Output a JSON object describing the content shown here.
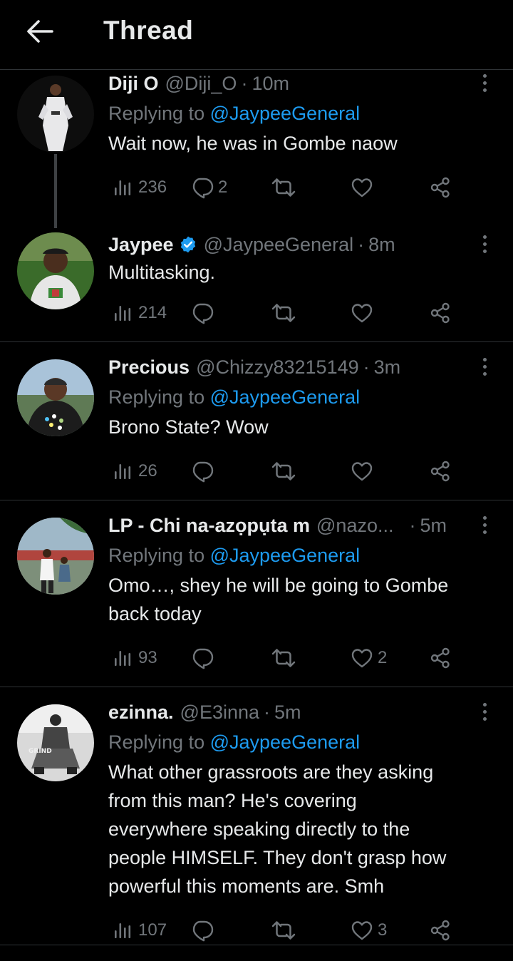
{
  "header": {
    "title": "Thread"
  },
  "tweets": [
    {
      "name": "Diji O",
      "handle": "@Diji_O",
      "dot": "·",
      "time": "10m",
      "replying_prefix": "Replying to ",
      "replying_to": "@JaypeeGeneral",
      "text": "Wait now, he was in Gombe naow",
      "views": "236",
      "replies": "2",
      "retweets": "",
      "likes": ""
    },
    {
      "name": "Jaypee",
      "verified": true,
      "handle": "@JaypeeGeneral",
      "dot": "·",
      "time": "8m",
      "text": "Multitasking.",
      "views": "214",
      "replies": "",
      "retweets": "",
      "likes": ""
    },
    {
      "name": "Precious",
      "handle": "@Chizzy83215149",
      "dot": "·",
      "time": "3m",
      "replying_prefix": "Replying to ",
      "replying_to": "@JaypeeGeneral",
      "text": "Brono State? Wow",
      "views": "26",
      "replies": "",
      "retweets": "",
      "likes": ""
    },
    {
      "name": "LP - Chi na-azọpụta m",
      "handle": "@nazo...",
      "dot": "·",
      "time": "5m",
      "replying_prefix": "Replying to ",
      "replying_to": "@JaypeeGeneral",
      "text_line1": "Omo…, shey he will be going to Gombe",
      "text_line2": "back today",
      "views": "93",
      "replies": "",
      "retweets": "",
      "likes": "2"
    },
    {
      "name": "ezinna.",
      "handle": "@E3inna",
      "dot": "·",
      "time": "5m",
      "replying_prefix": "Replying to ",
      "replying_to": "@JaypeeGeneral",
      "text_lines": [
        "What other grassroots are they asking",
        "from this man? He's covering",
        "everywhere speaking directly to the",
        "people HIMSELF. They don't grasp how",
        "powerful this moments are. Smh"
      ],
      "avatar_text": "GRIND",
      "views": "107",
      "replies": "",
      "retweets": "",
      "likes": "3"
    }
  ],
  "colors": {
    "background": "#000000",
    "primary_text": "#e7e9ea",
    "secondary_text": "#71767b",
    "link": "#1d9bf0",
    "divider": "#2f3336",
    "verified": "#1d9bf0"
  },
  "icons": {
    "back": "arrow-left-icon",
    "more": "more-vertical-icon",
    "views": "analytics-icon",
    "reply": "reply-bubble-icon",
    "retweet": "retweet-icon",
    "like": "heart-icon",
    "share": "share-icon",
    "verified": "verified-badge-icon"
  }
}
